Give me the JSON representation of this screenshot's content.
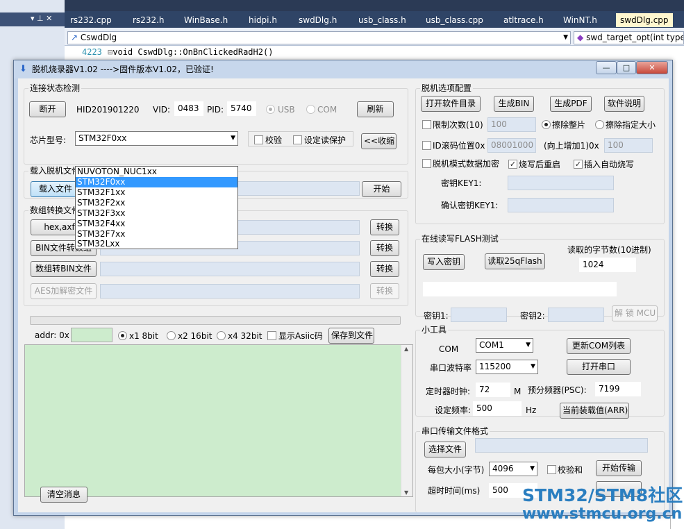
{
  "ide": {
    "tabs": [
      "rs232.cpp",
      "rs232.h",
      "WinBase.h",
      "hidpi.h",
      "swdDlg.h",
      "usb_class.h",
      "usb_class.cpp",
      "atltrace.h",
      "WinNT.h",
      "swdDlg.cpp"
    ],
    "class_combo": "CswdDlg",
    "member_combo": "swd_target_opt(int type)",
    "line_number": "4223",
    "code_line": "void CswdDlg::OnBnClickedRadH2()"
  },
  "window": {
    "title": "脱机烧录器V1.02      ---->固件版本V1.02，已验证!",
    "minimize": "—",
    "maximize": "□",
    "close": "✕"
  },
  "conn": {
    "title": "连接状态检测",
    "disconnect": "断开",
    "hid": "HID201901220",
    "vid_label": "VID:",
    "vid": "0483",
    "pid_label": "PID:",
    "pid": "5740",
    "usb_label": "USB",
    "com_label": "COM",
    "refresh": "刷新",
    "chip_label": "芯片型号:",
    "chip_selected": "STM32F0xx",
    "verify_label": "校验",
    "readprotect_label": "设定读保护",
    "collapse": "<<收缩",
    "chip_options": [
      "NUVOTON_NUC1xx",
      "STM32F0xx",
      "STM32F1xx",
      "STM32F2xx",
      "STM32F3xx",
      "STM32F4xx",
      "STM32F7xx",
      "STM32Lxx"
    ]
  },
  "load": {
    "title": "载入脱机文件",
    "load_button": "载入文件",
    "start": "开始"
  },
  "convert": {
    "title": "数组转换文件",
    "rows": [
      {
        "button": "hex,axf转",
        "action": "转换"
      },
      {
        "button": "BIN文件转数组",
        "action": "转换"
      },
      {
        "button": "数组转BIN文件",
        "action": "转换"
      },
      {
        "button": "AES加解密文件",
        "action": "转换"
      }
    ]
  },
  "log": {
    "addr_label": "addr: 0x",
    "x1": "x1 8bit",
    "x2": "x2 16bit",
    "x4": "x4 32bit",
    "ascii": "显示Asiic码",
    "save": "保存到文件",
    "clear": "清空消息"
  },
  "offline": {
    "title": "脱机选项配置",
    "open_dir": "打开软件目录",
    "gen_bin": "生成BIN",
    "gen_pdf": "生成PDF",
    "manual": "软件说明",
    "limit_label": "限制次数(10)",
    "limit_value": "100",
    "erase_all": "擦除整片",
    "erase_size": "擦除指定大小",
    "id_label": "ID滚码位置0x",
    "id_value": "08001000",
    "inc_label": "(向上增加1)0x",
    "inc_value": "100",
    "encrypt": "脱机模式数据加密",
    "restart": "烧写后重启",
    "autoburn": "插入自动烧写",
    "key1": "密钥KEY1:",
    "key1_confirm": "确认密钥KEY1:"
  },
  "flash": {
    "title": "在线读写FLASH测试",
    "write_key": "写入密钥",
    "read_flash": "读取25qFlash",
    "bytes_label": "读取的字节数(10进制)",
    "bytes_value": "1024",
    "key1": "密钥1:",
    "key2": "密钥2:",
    "unlock": "解 锁 MCU"
  },
  "tools": {
    "title": "小工具",
    "com_label": "COM",
    "com_value": "COM1",
    "refresh_com": "更新COM列表",
    "baud_label": "串口波特率",
    "baud_value": "115200",
    "open_port": "打开串口",
    "timer_label": "定时器时钟:",
    "timer_value": "72",
    "timer_unit": "M",
    "psc_label": "预分频器(PSC):",
    "psc_value": "7199",
    "freq_label": "设定频率:",
    "freq_value": "500",
    "freq_unit": "Hz",
    "arr": "当前装载值(ARR)"
  },
  "serial": {
    "title": "串口传输文件格式",
    "select_file": "选择文件",
    "packet_label": "每包大小(字节)",
    "packet_value": "4096",
    "checksum": "校验和",
    "start": "开始传输",
    "timeout_label": "超时时间(ms)",
    "timeout_value": "500"
  },
  "watermark": {
    "line1": "STM32/STM8社区",
    "line2": "www.stmcu.org.cn"
  }
}
